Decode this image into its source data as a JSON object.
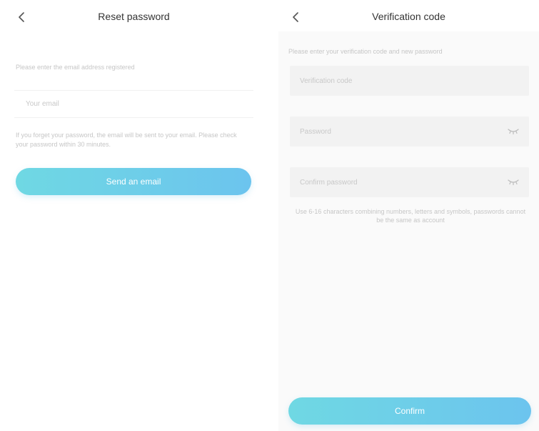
{
  "reset_screen": {
    "title": "Reset password",
    "instruction": "Please enter the email address registered",
    "email_placeholder": "Your email",
    "note": "If you forget your password, the email will be sent to your email. Please check your password within 30 minutes.",
    "send_button_label": "Send an email"
  },
  "verify_screen": {
    "title": "Verification code",
    "instruction": "Please enter your verification code and new password",
    "code_placeholder": "Verification code",
    "password_placeholder": "Password",
    "confirm_placeholder": "Confirm password",
    "rule_text": "Use 6-16 characters combining numbers, letters and symbols, passwords cannot be the same as account",
    "confirm_button_label": "Confirm"
  },
  "icons": {
    "back": "chevron-left-icon",
    "eye": "eye-closed-icon"
  },
  "colors": {
    "button_gradient_start": "#6fd8e3",
    "button_gradient_end": "#6cc4ee"
  }
}
